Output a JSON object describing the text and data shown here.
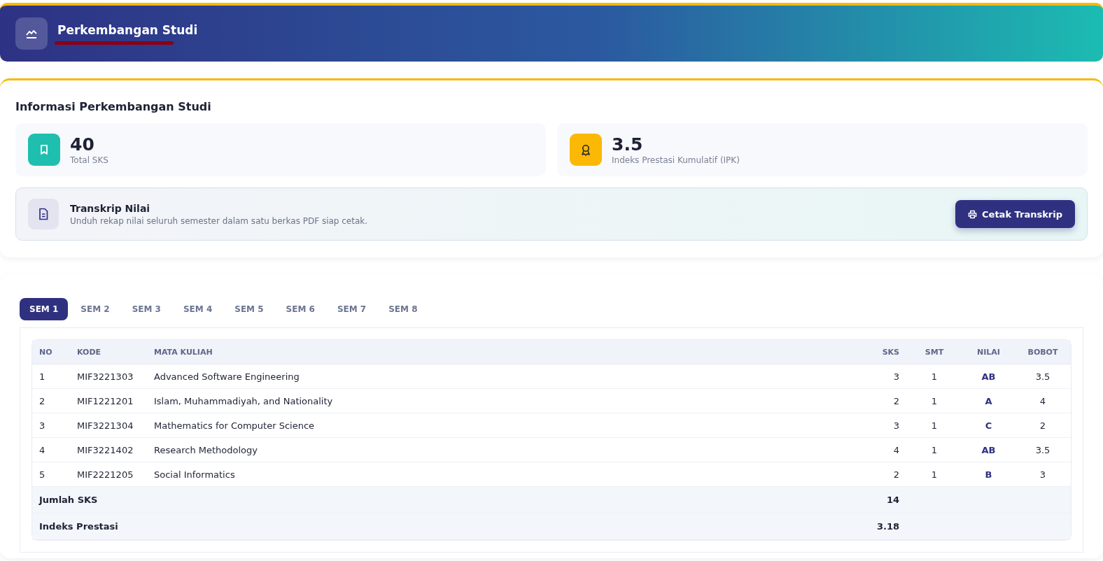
{
  "header": {
    "title": "Perkembangan Studi"
  },
  "info": {
    "title": "Informasi Perkembangan Studi",
    "stats": [
      {
        "kind": "credits",
        "value": "40",
        "label": "Total SKS"
      },
      {
        "kind": "gpa",
        "value": "3.5",
        "label": "Indeks Prestasi Kumulatif (IPK)"
      }
    ],
    "transcript": {
      "title": "Transkrip Nilai",
      "description": "Unduh rekap nilai seluruh semester dalam satu berkas PDF siap cetak.",
      "button": "Cetak Transkrip"
    }
  },
  "tabs": [
    {
      "label": "SEM 1",
      "selected": true
    },
    {
      "label": "SEM 2",
      "selected": false
    },
    {
      "label": "SEM 3",
      "selected": false
    },
    {
      "label": "SEM 4",
      "selected": false
    },
    {
      "label": "SEM 5",
      "selected": false
    },
    {
      "label": "SEM 6",
      "selected": false
    },
    {
      "label": "SEM 7",
      "selected": false
    },
    {
      "label": "SEM 8",
      "selected": false
    }
  ],
  "table": {
    "columns": [
      "NO",
      "KODE",
      "MATA KULIAH",
      "SKS",
      "SMT",
      "NILAI",
      "BOBOT"
    ],
    "rows": [
      [
        "1",
        "MIF3221303",
        "Advanced Software Engineering",
        "3",
        "1",
        "AB",
        "3.5"
      ],
      [
        "2",
        "MIF1221201",
        "Islam, Muhammadiyah, and Nationality",
        "2",
        "1",
        "A",
        "4"
      ],
      [
        "3",
        "MIF3221304",
        "Mathematics for Computer Science",
        "3",
        "1",
        "C",
        "2"
      ],
      [
        "4",
        "MIF3221402",
        "Research Methodology",
        "4",
        "1",
        "AB",
        "3.5"
      ],
      [
        "5",
        "MIF2221205",
        "Social Informatics",
        "2",
        "1",
        "B",
        "3"
      ]
    ],
    "totals": [
      {
        "label": "Jumlah SKS",
        "value": "14"
      },
      {
        "label": "Indeks Prestasi",
        "value": "3.18"
      }
    ]
  }
}
